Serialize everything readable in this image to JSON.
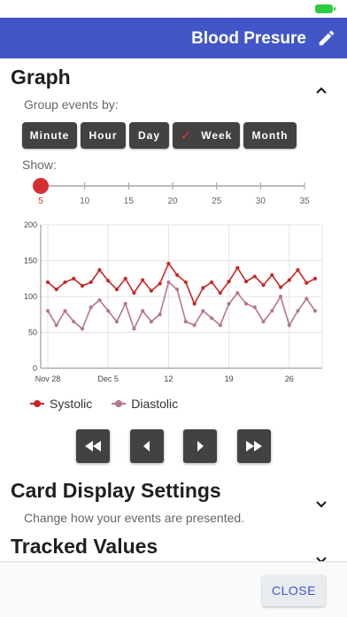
{
  "app": {
    "title": "Blood Presure"
  },
  "graph_section": {
    "title": "Graph",
    "group_label": "Group events by:",
    "group_options": [
      "Minute",
      "Hour",
      "Day",
      "Week",
      "Month"
    ],
    "selected_group": "Week",
    "show_label": "Show:",
    "slider": {
      "ticks": [
        "5",
        "10",
        "15",
        "20",
        "25",
        "30",
        "35"
      ],
      "value": 5,
      "min": 5,
      "max": 35
    }
  },
  "chart_data": {
    "type": "line",
    "ylim": [
      0,
      200
    ],
    "yticks": [
      "0",
      "50",
      "100",
      "150",
      "200"
    ],
    "xticks": [
      "Nov 28",
      "Dec 5",
      "12",
      "19",
      "26"
    ],
    "series": [
      {
        "name": "Systolic",
        "color": "#c62828",
        "values": [
          120,
          110,
          120,
          125,
          115,
          120,
          137,
          122,
          110,
          125,
          105,
          123,
          108,
          118,
          146,
          130,
          120,
          90,
          112,
          120,
          105,
          121,
          140,
          121,
          128,
          116,
          130,
          113,
          123,
          137,
          119,
          125
        ]
      },
      {
        "name": "Diastolic",
        "color": "#b5768f",
        "values": [
          80,
          60,
          80,
          65,
          55,
          85,
          95,
          80,
          65,
          90,
          55,
          80,
          65,
          75,
          120,
          110,
          65,
          60,
          80,
          70,
          60,
          90,
          105,
          90,
          85,
          65,
          80,
          100,
          60,
          80,
          97,
          80
        ]
      }
    ]
  },
  "navigation": [
    "first-page",
    "previous",
    "next",
    "last-page"
  ],
  "card_display": {
    "title": "Card Display Settings",
    "subtitle": "Change how your events are presented."
  },
  "tracked": {
    "title": "Tracked Values"
  },
  "footer": {
    "close_label": "CLOSE"
  },
  "colors": {
    "app_bar": "#4256c8",
    "chip": "#424242",
    "slider": "#d32f2f"
  }
}
